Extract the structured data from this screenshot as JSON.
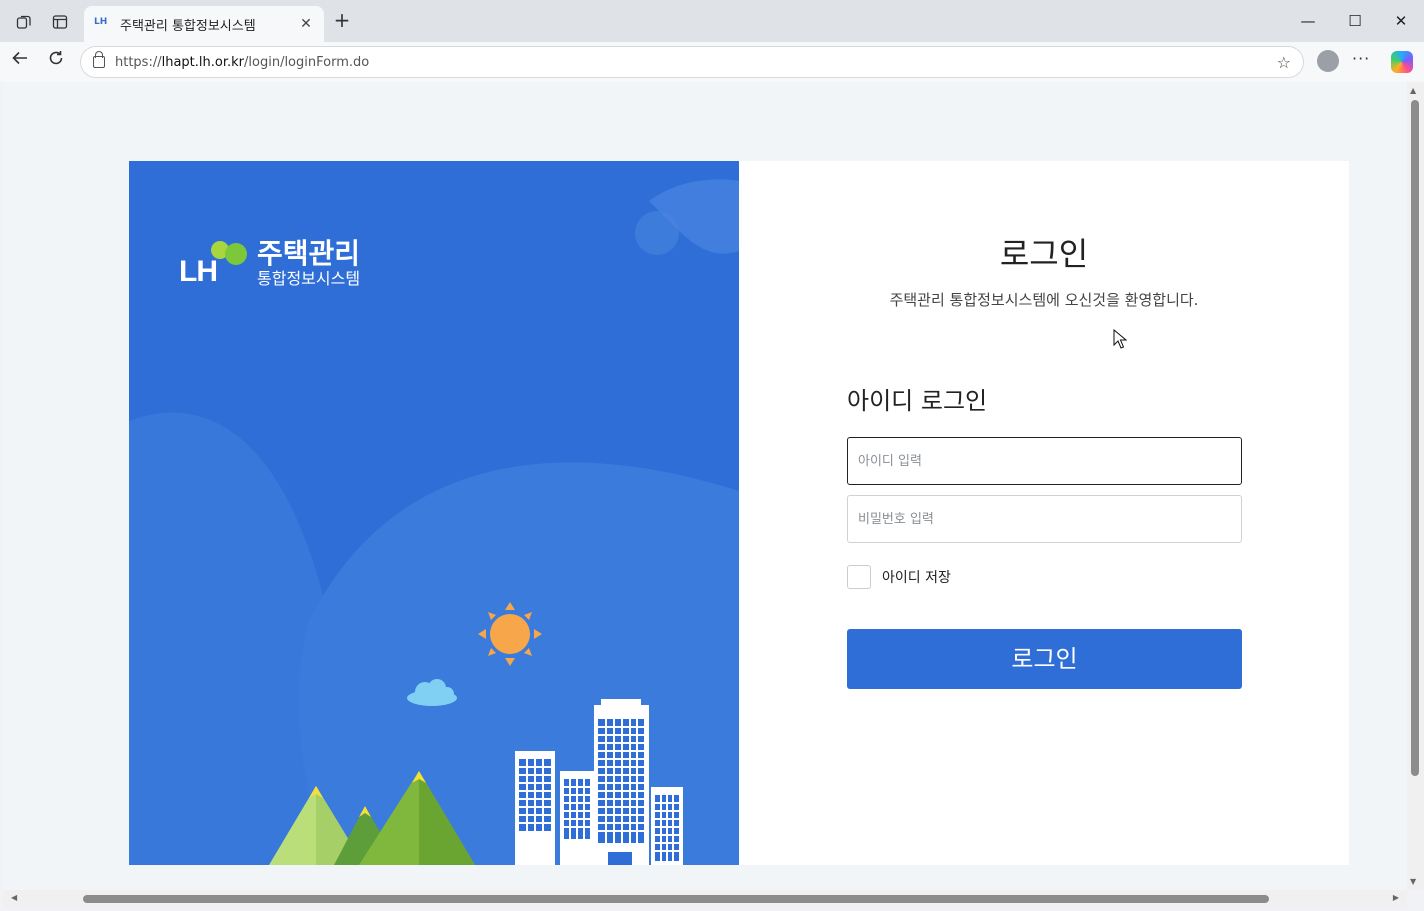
{
  "browser": {
    "tab_title": "주택관리 통합정보시스템",
    "tab_favicon_text": "LH",
    "url_prefix": "https://",
    "url_host": "lhapt.lh.or.kr",
    "url_path": "/login/loginForm.do"
  },
  "brand": {
    "logo_text": "LH",
    "title": "주택관리",
    "subtitle": "통합정보시스템"
  },
  "login": {
    "title": "로그인",
    "welcome": "주택관리 통합정보시스템에 오신것을 환영합니다.",
    "section_title": "아이디 로그인",
    "id_placeholder": "아이디 입력",
    "password_placeholder": "비밀번호 입력",
    "remember_label": "아이디 저장",
    "submit_label": "로그인"
  },
  "colors": {
    "primary": "#2e6ed6",
    "panel_bg": "#ffffff",
    "page_bg": "#f2f5f8"
  }
}
